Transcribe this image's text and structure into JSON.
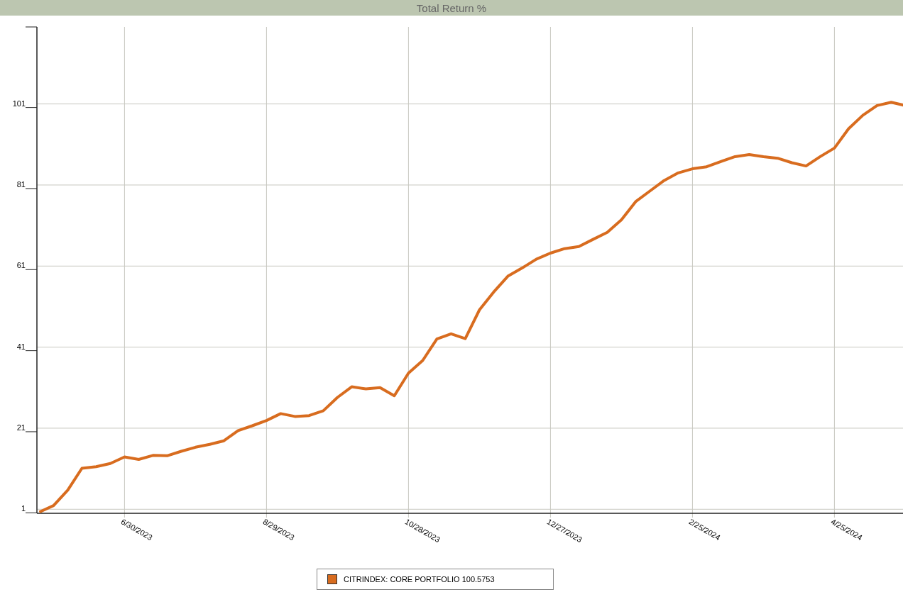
{
  "chart_data": {
    "type": "line",
    "title": "Total Return %",
    "categories": [
      null,
      null,
      null,
      null,
      null,
      null,
      "6/30/2023",
      null,
      null,
      null,
      null,
      null,
      null,
      null,
      null,
      null,
      "8/29/2023",
      null,
      null,
      null,
      null,
      null,
      null,
      null,
      null,
      null,
      "10/28/2023",
      null,
      null,
      null,
      null,
      null,
      null,
      null,
      null,
      null,
      "12/27/2023",
      null,
      null,
      null,
      null,
      null,
      null,
      null,
      null,
      null,
      "2/25/2024",
      null,
      null,
      null,
      null,
      null,
      null,
      null,
      null,
      null,
      "4/25/2024",
      null,
      null,
      null,
      null,
      null
    ],
    "series": [
      {
        "name": "CITRINDEX: CORE PORTFOLIO",
        "color": "#d86c1f",
        "values": [
          0.3,
          1.9,
          5.7,
          11.1,
          11.5,
          12.3,
          13.9,
          13.3,
          14.3,
          14.2,
          15.3,
          16.3,
          17.0,
          17.9,
          20.4,
          21.6,
          22.9,
          24.6,
          23.9,
          24.1,
          25.3,
          28.6,
          31.2,
          30.7,
          31.0,
          29.0,
          34.6,
          37.7,
          43.0,
          44.3,
          43.1,
          50.2,
          54.6,
          58.5,
          60.5,
          62.7,
          64.2,
          65.3,
          65.8,
          67.6,
          69.3,
          72.4,
          76.9,
          79.5,
          82.1,
          84.0,
          85.0,
          85.5,
          86.8,
          88.0,
          88.5,
          88.0,
          87.6,
          86.5,
          85.7,
          88.0,
          90.1,
          94.9,
          98.2,
          100.6,
          101.4,
          100.6
        ]
      }
    ],
    "grid": true,
    "ylim": [
      0,
      120
    ],
    "yticks": [
      1,
      21,
      41,
      61,
      81,
      101
    ]
  },
  "legend": {
    "value": "100.5753"
  }
}
